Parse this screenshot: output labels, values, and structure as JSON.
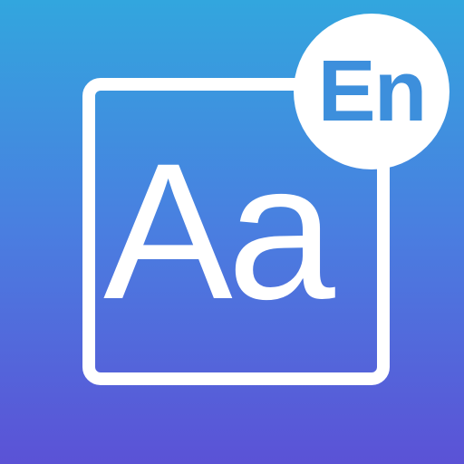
{
  "icon": {
    "glyph_text": "Aa",
    "badge_text": "En",
    "colors": {
      "gradient_top": "#32a6de",
      "gradient_bottom": "#5b52d6",
      "foreground": "#ffffff",
      "badge_text": "#3d8fdc"
    }
  }
}
